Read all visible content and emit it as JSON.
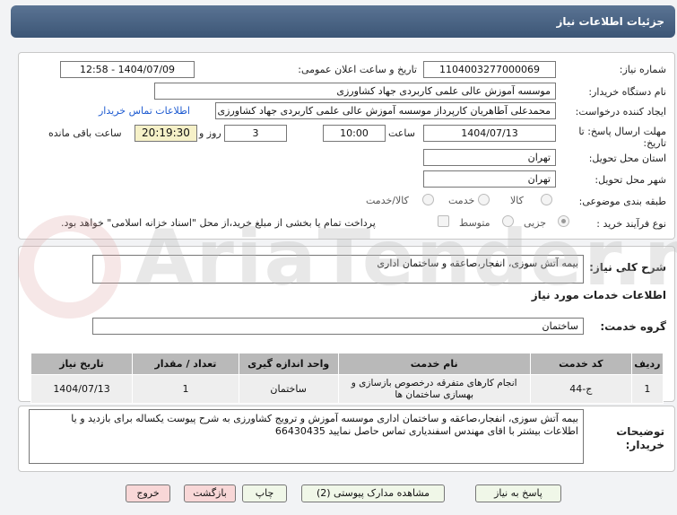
{
  "header": {
    "title": "جزئیات اطلاعات نیاز"
  },
  "labels": {
    "need_number": "شماره نیاز:",
    "announce_datetime": "تاریخ و ساعت اعلان عمومی:",
    "buyer_org": "نام دستگاه خریدار:",
    "request_creator": "ایجاد کننده درخواست:",
    "deadline": "مهلت ارسال پاسخ: تا تاریخ:",
    "hour": "ساعت",
    "day_and": "روز و",
    "remaining": "ساعت باقی مانده",
    "province": "استان محل تحویل:",
    "city": "شهر محل تحویل:",
    "subject_class": "طبقه بندی موضوعی:",
    "process_type": "نوع فرآیند خرید :",
    "description": "شرح کلی نیاز:",
    "services_info": "اطلاعات خدمات مورد نیاز",
    "service_group": "گروه خدمت:",
    "buyer_notes": "توضیحات خریدار:"
  },
  "values": {
    "need_number": "1104003277000069",
    "announce_datetime": "1404/07/09 - 12:58",
    "buyer_org": "موسسه آموزش عالی علمی کاربردی جهاد کشاورزی",
    "request_creator": "محمدعلی آطاهریان کارپرداز موسسه آموزش عالی علمی کاربردی جهاد کشاورزی",
    "contact_link": "اطلاعات تماس خریدار",
    "deadline_date": "1404/07/13",
    "deadline_time": "10:00",
    "days": "3",
    "remaining_time": "20:19:30",
    "province": "تهران",
    "city": "تهران",
    "description": "بیمه آتش سوزی، انفجار،صاعقه  و ساختمان اداری",
    "service_group": "ساختمان",
    "buyer_notes": "بیمه آتش سوزی، انفجار،صاعقه  و ساختمان اداری موسسه آموزش و ترویج کشاورزی به شرح پیوست یکساله برای بازدید و یا اطلاعات بیشتر با اقای مهندس اسفندیاری تماس حاصل نمایید 66430435"
  },
  "subject_options": [
    "کالا",
    "خدمت",
    "کالا/خدمت"
  ],
  "process_options": [
    "جزیی",
    "متوسط"
  ],
  "payment_note": "پرداخت تمام یا بخشی از مبلغ خرید،از محل \"اسناد خزانه اسلامی\" خواهد بود.",
  "table": {
    "headers": [
      "ردیف",
      "کد خدمت",
      "نام خدمت",
      "واحد اندازه گیری",
      "تعداد / مقدار",
      "تاریخ نیاز"
    ],
    "rows": [
      [
        "1",
        "ج-44",
        "انجام کارهای متفرقه درخصوص بازسازی و بهسازی ساختمان ها",
        "ساختمان",
        "1",
        "1404/07/13"
      ]
    ]
  },
  "buttons": {
    "reply": "پاسخ به نیاز",
    "view_docs": "مشاهده مدارک پیوستی (2)",
    "print": "چاپ",
    "back": "بازگشت",
    "exit": "خروج"
  },
  "watermark": "AriaTender.net"
}
